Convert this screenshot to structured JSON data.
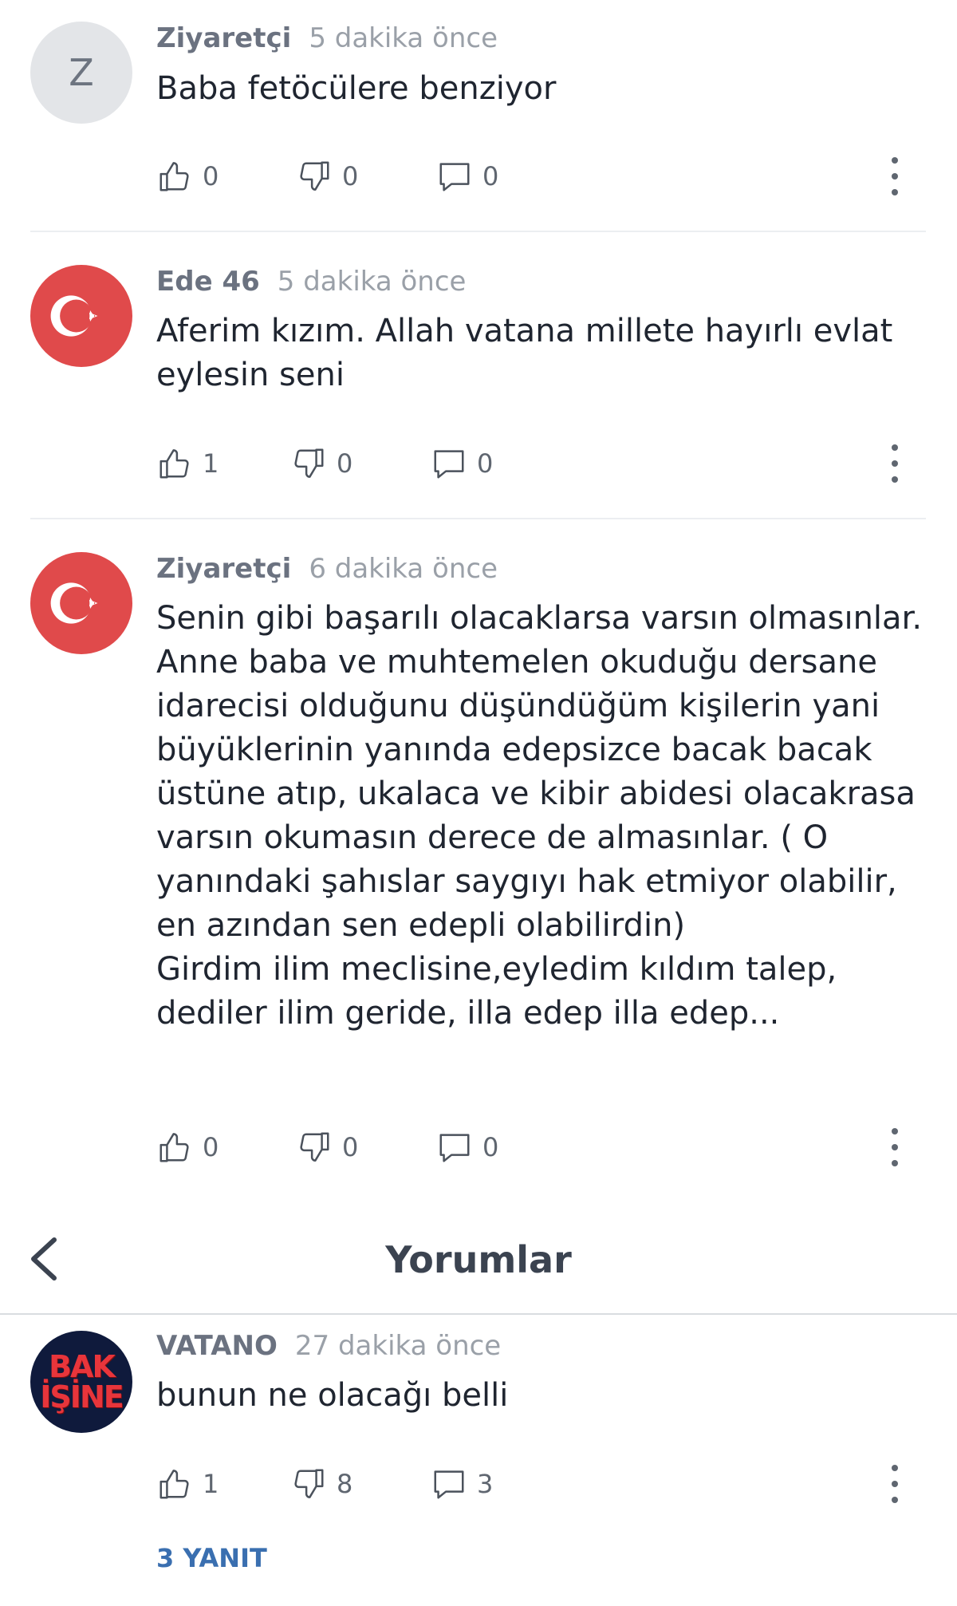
{
  "comments": [
    {
      "author": "Ziyaretçi",
      "time": "5 dakika önce",
      "avatar_letter": "Z",
      "text": "Baba fetöcülere benziyor",
      "likes": "0",
      "dislikes": "0",
      "replies": "0"
    },
    {
      "author": "Ede 46",
      "time": "5 dakika önce",
      "text": "Aferim kızım. Allah vatana millete hayırlı evlat eylesin seni",
      "likes": "1",
      "dislikes": "0",
      "replies": "0"
    },
    {
      "author": "Ziyaretçi",
      "time": "6 dakika önce",
      "text": "Senin gibi başarılı olacaklarsa varsın olmasınlar. Anne baba ve muhtemelen okuduğu dersane idarecisi olduğunu düşündüğüm kişilerin yani büyüklerinin yanında edepsizce bacak bacak üstüne atıp, ukalaca ve kibir abidesi olacakrasa varsın okumasın derece de almasınlar. ( O yanındaki şahıslar saygıyı hak etmiyor olabilir, en azından sen edepli olabilirdin)",
      "text2": "Girdim ilim meclisine,eyledim kıldım talep, dediler ilim geride, illa edep illa edep...",
      "likes": "0",
      "dislikes": "0",
      "replies": "0"
    }
  ],
  "header": {
    "title": "Yorumlar"
  },
  "top_comment": {
    "author": "VATANO",
    "time": "27 dakika önce",
    "avatar_line1": "BAK",
    "avatar_line2": "İŞİNE",
    "text": "bunun ne olacağı belli",
    "likes": "1",
    "dislikes": "8",
    "replies": "3",
    "replies_link": "3 YANIT"
  },
  "colors": {
    "flag_red": "#e04a4b",
    "link_blue": "#3a6fb0",
    "text": "#1f2530",
    "muted": "#9aa0a8"
  },
  "icons": [
    "thumbs-up-icon",
    "thumbs-down-icon",
    "comment-bubble-icon",
    "more-vertical-icon",
    "back-chevron-icon",
    "turkish-flag-icon"
  ]
}
